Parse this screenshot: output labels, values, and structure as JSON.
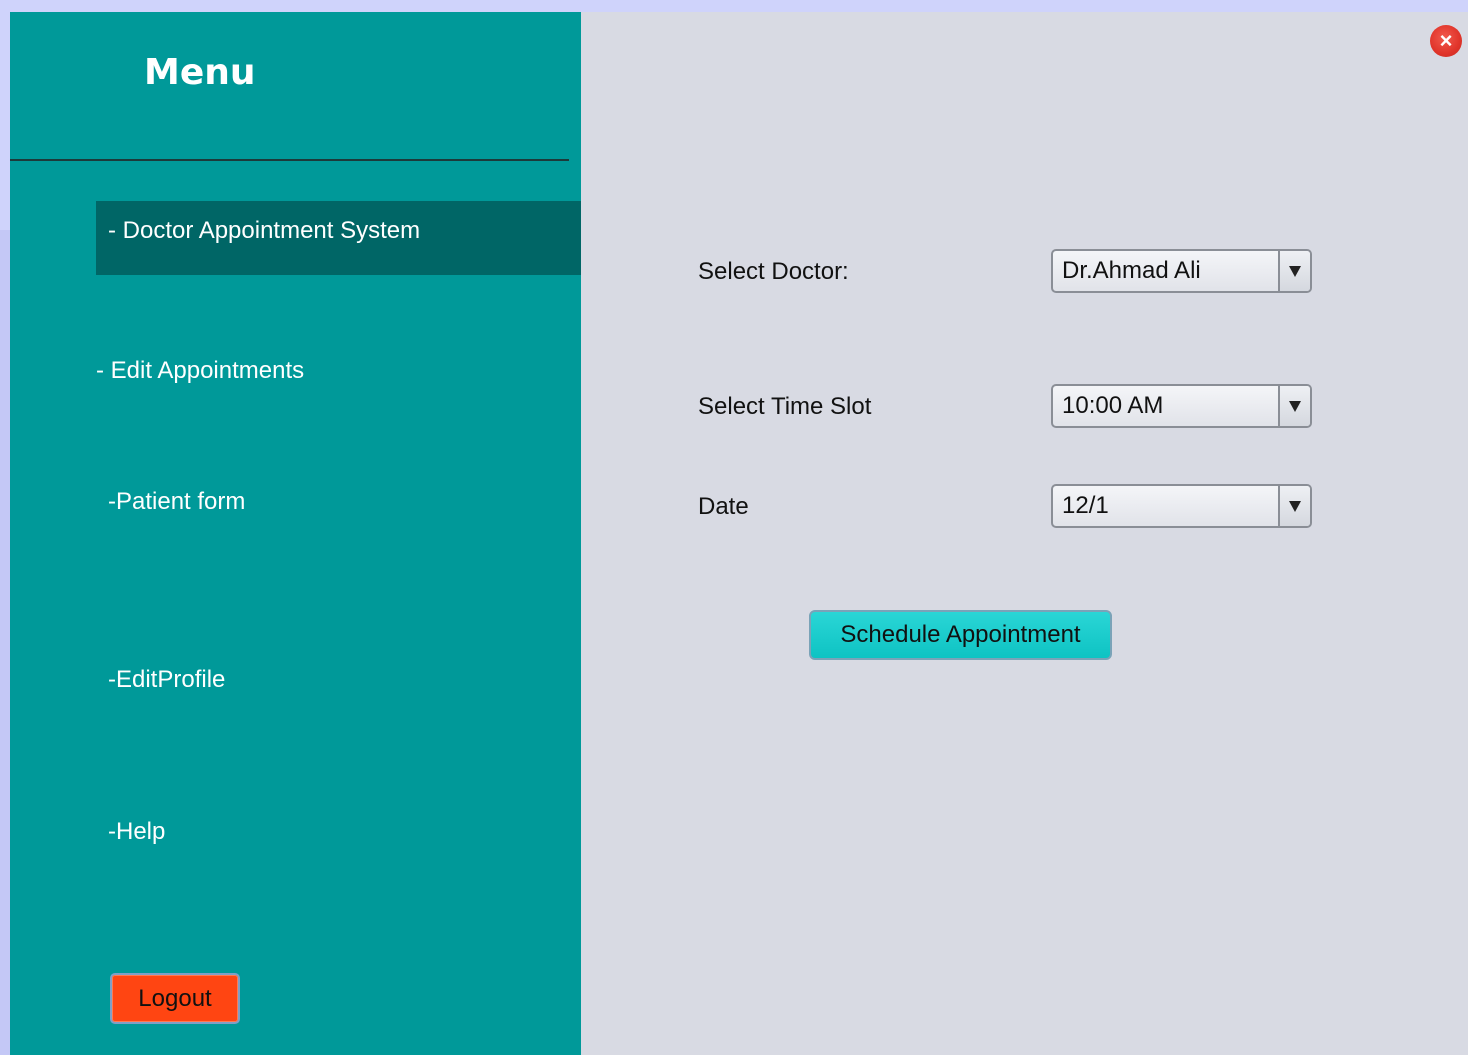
{
  "sidebar": {
    "title": "Menu",
    "items": [
      {
        "label": "- Doctor Appointment System",
        "active": true
      },
      {
        "label": "- Edit Appointments"
      },
      {
        "label": "-Patient form"
      },
      {
        "label": "-EditProfile"
      },
      {
        "label": "-Help"
      }
    ],
    "logout_label": "Logout"
  },
  "form": {
    "doctor_label": "Select Doctor:",
    "doctor_value": "Dr.Ahmad Ali",
    "time_label": "Select Time Slot",
    "time_value": "10:00 AM",
    "date_label": "Date",
    "date_value": "12/1",
    "schedule_label": "Schedule Appointment"
  },
  "window": {
    "close_icon": "close-icon"
  },
  "colors": {
    "sidebar": "#009999",
    "sidebar_active": "#006666",
    "content": "#d8dae3",
    "logout": "#ff4512",
    "schedule": "#1acccc",
    "close": "#e0342a"
  }
}
